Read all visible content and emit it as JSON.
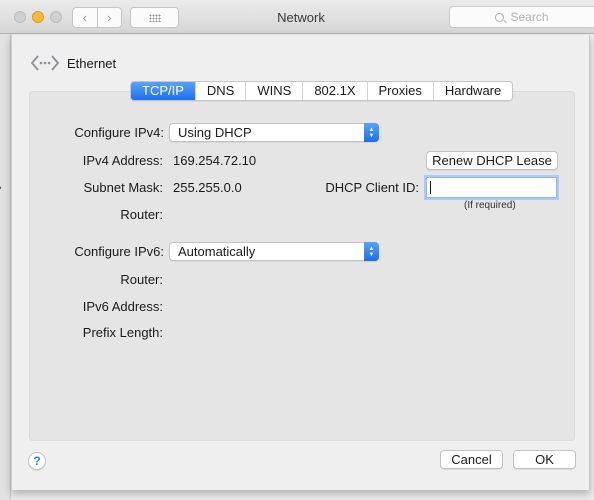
{
  "window": {
    "title": "Network",
    "search_placeholder": "Search",
    "nav_back": "‹",
    "nav_forward": "›"
  },
  "interface": {
    "name": "Ethernet",
    "icon": "ethernet-icon"
  },
  "tabs": [
    {
      "label": "TCP/IP",
      "active": true
    },
    {
      "label": "DNS",
      "active": false
    },
    {
      "label": "WINS",
      "active": false
    },
    {
      "label": "802.1X",
      "active": false
    },
    {
      "label": "Proxies",
      "active": false
    },
    {
      "label": "Hardware",
      "active": false
    }
  ],
  "ipv4": {
    "configure_label": "Configure IPv4:",
    "configure_value": "Using DHCP",
    "address_label": "IPv4 Address:",
    "address_value": "169.254.72.10",
    "subnet_label": "Subnet Mask:",
    "subnet_value": "255.255.0.0",
    "router_label": "Router:",
    "router_value": "",
    "renew_button": "Renew DHCP Lease",
    "client_id_label": "DHCP Client ID:",
    "client_id_value": "",
    "client_id_hint": "(If required)"
  },
  "ipv6": {
    "configure_label": "Configure IPv6:",
    "configure_value": "Automatically",
    "router_label": "Router:",
    "address_label": "IPv6 Address:",
    "prefix_label": "Prefix Length:"
  },
  "footer": {
    "help": "?",
    "cancel": "Cancel",
    "ok": "OK"
  },
  "colors": {
    "accent": "#1a6ff0",
    "minimize": "#f6b93b"
  }
}
